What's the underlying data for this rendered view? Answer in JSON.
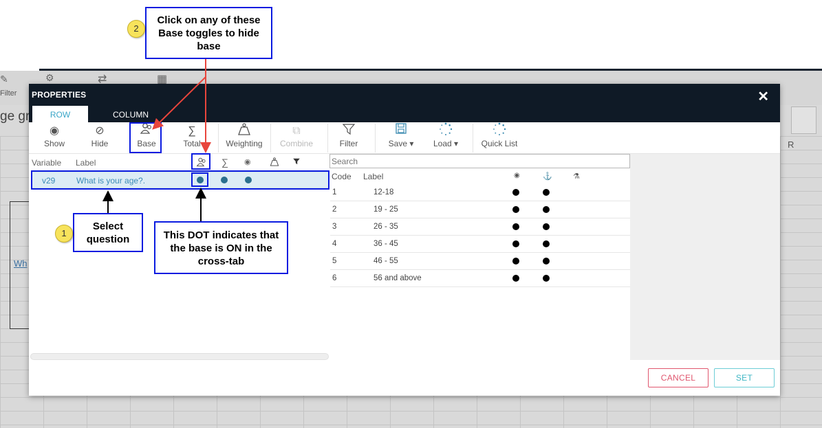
{
  "background": {
    "filter_label": "Filter",
    "title_fragment": "ge gr",
    "column_letter": "R",
    "link_fragment": "Wh"
  },
  "modal": {
    "title": "PROPERTIES",
    "close_glyph": "✕",
    "tabs": [
      {
        "label": "ROW",
        "active": true
      },
      {
        "label": "COLUMN",
        "active": false
      }
    ],
    "toolbar": [
      {
        "label": "Show",
        "icon": "eye-icon"
      },
      {
        "label": "Hide",
        "icon": "eye-slash-icon"
      },
      {
        "label": "Base",
        "icon": "base-users-icon"
      },
      {
        "label": "Total",
        "icon": "sigma-icon"
      },
      {
        "label": "Weighting",
        "icon": "weight-icon"
      },
      {
        "label": "Combine",
        "icon": "combine-icon",
        "disabled": true
      },
      {
        "label": "Filter",
        "icon": "funnel-icon"
      },
      {
        "label": "Save ▾",
        "icon": "save-icon"
      },
      {
        "label": "Load ▾",
        "icon": "load-spinner-icon"
      },
      {
        "label": "Quick List",
        "icon": "quick-list-icon"
      }
    ],
    "left_pane": {
      "columns": [
        "Variable",
        "Label"
      ],
      "rows": [
        {
          "variable": "v29",
          "label": "What is your age?.",
          "base": true,
          "total": true,
          "show": true
        }
      ]
    },
    "right_pane": {
      "search_placeholder": "Search",
      "columns": [
        "Code",
        "Label"
      ],
      "rows": [
        {
          "code": "1",
          "label": "12-18"
        },
        {
          "code": "2",
          "label": "19 - 25"
        },
        {
          "code": "3",
          "label": "26 - 35"
        },
        {
          "code": "4",
          "label": "36 - 45"
        },
        {
          "code": "5",
          "label": "46 - 55"
        },
        {
          "code": "6",
          "label": "56 and above"
        }
      ]
    },
    "buttons": {
      "cancel": "CANCEL",
      "set": "SET"
    }
  },
  "annotations": {
    "callout_toggles": "Click on any of these Base toggles to hide base",
    "callout_select": "Select question",
    "callout_dot": "This DOT indicates that the base is ON in the cross-tab",
    "step1": "1",
    "step2": "2",
    "highlight_color": "#0a1be0",
    "arrow_color": "#e8453c"
  }
}
